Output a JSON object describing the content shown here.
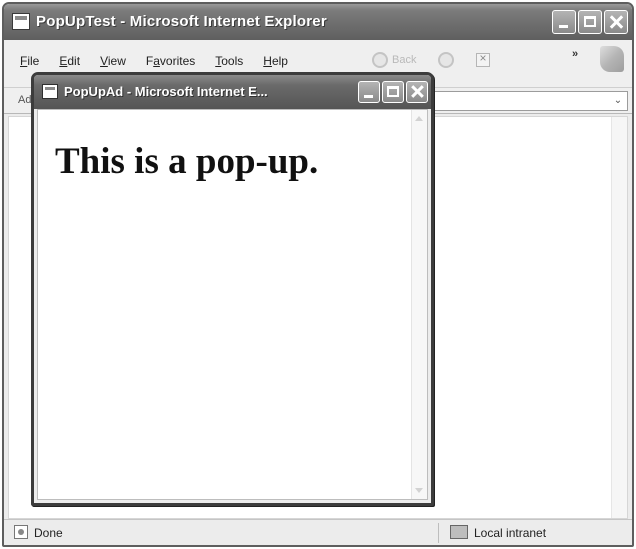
{
  "main_window": {
    "title": "PopUpTest - Microsoft Internet Explorer",
    "menu": [
      {
        "mnemonic": "F",
        "rest": "ile"
      },
      {
        "mnemonic": "E",
        "rest": "dit"
      },
      {
        "mnemonic": "V",
        "rest": "iew"
      },
      {
        "pre": "F",
        "mnemonic": "a",
        "rest": "vorites"
      },
      {
        "mnemonic": "T",
        "rest": "ools"
      },
      {
        "mnemonic": "H",
        "rest": "elp"
      }
    ],
    "toolbar": {
      "back_label": "Back",
      "chevron": "»"
    },
    "address": {
      "label": "Ad",
      "value": "",
      "dropdown_glyph": "⌄"
    },
    "status": {
      "text": "Done",
      "zone": "Local intranet"
    }
  },
  "popup_window": {
    "title": "PopUpAd - Microsoft Internet E...",
    "heading": "This is a pop-up."
  }
}
